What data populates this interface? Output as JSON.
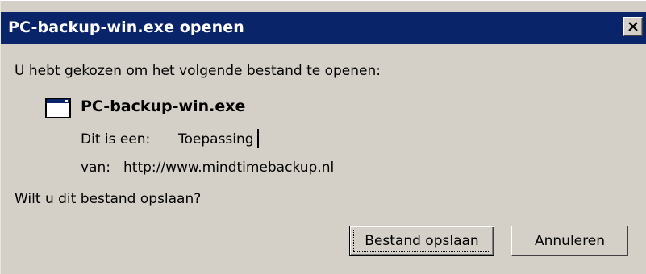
{
  "window": {
    "title": "PC-backup-win.exe openen",
    "close_symbol": "X"
  },
  "dialog": {
    "intro": "U hebt gekozen om het volgende bestand te openen:",
    "file": {
      "name": "PC-backup-win.exe",
      "icon": "application-window-icon",
      "type_label": "Dit is een:",
      "type_value": "Toepassing",
      "from_label": "van:",
      "from_value": "http://www.mindtimebackup.nl"
    },
    "question": "Wilt u dit bestand opslaan?"
  },
  "buttons": {
    "save_label": "Bestand opslaan",
    "cancel_label": "Annuleren"
  },
  "colors": {
    "titlebar": "#0a246a",
    "dialog_bg": "#d4d0c8"
  }
}
